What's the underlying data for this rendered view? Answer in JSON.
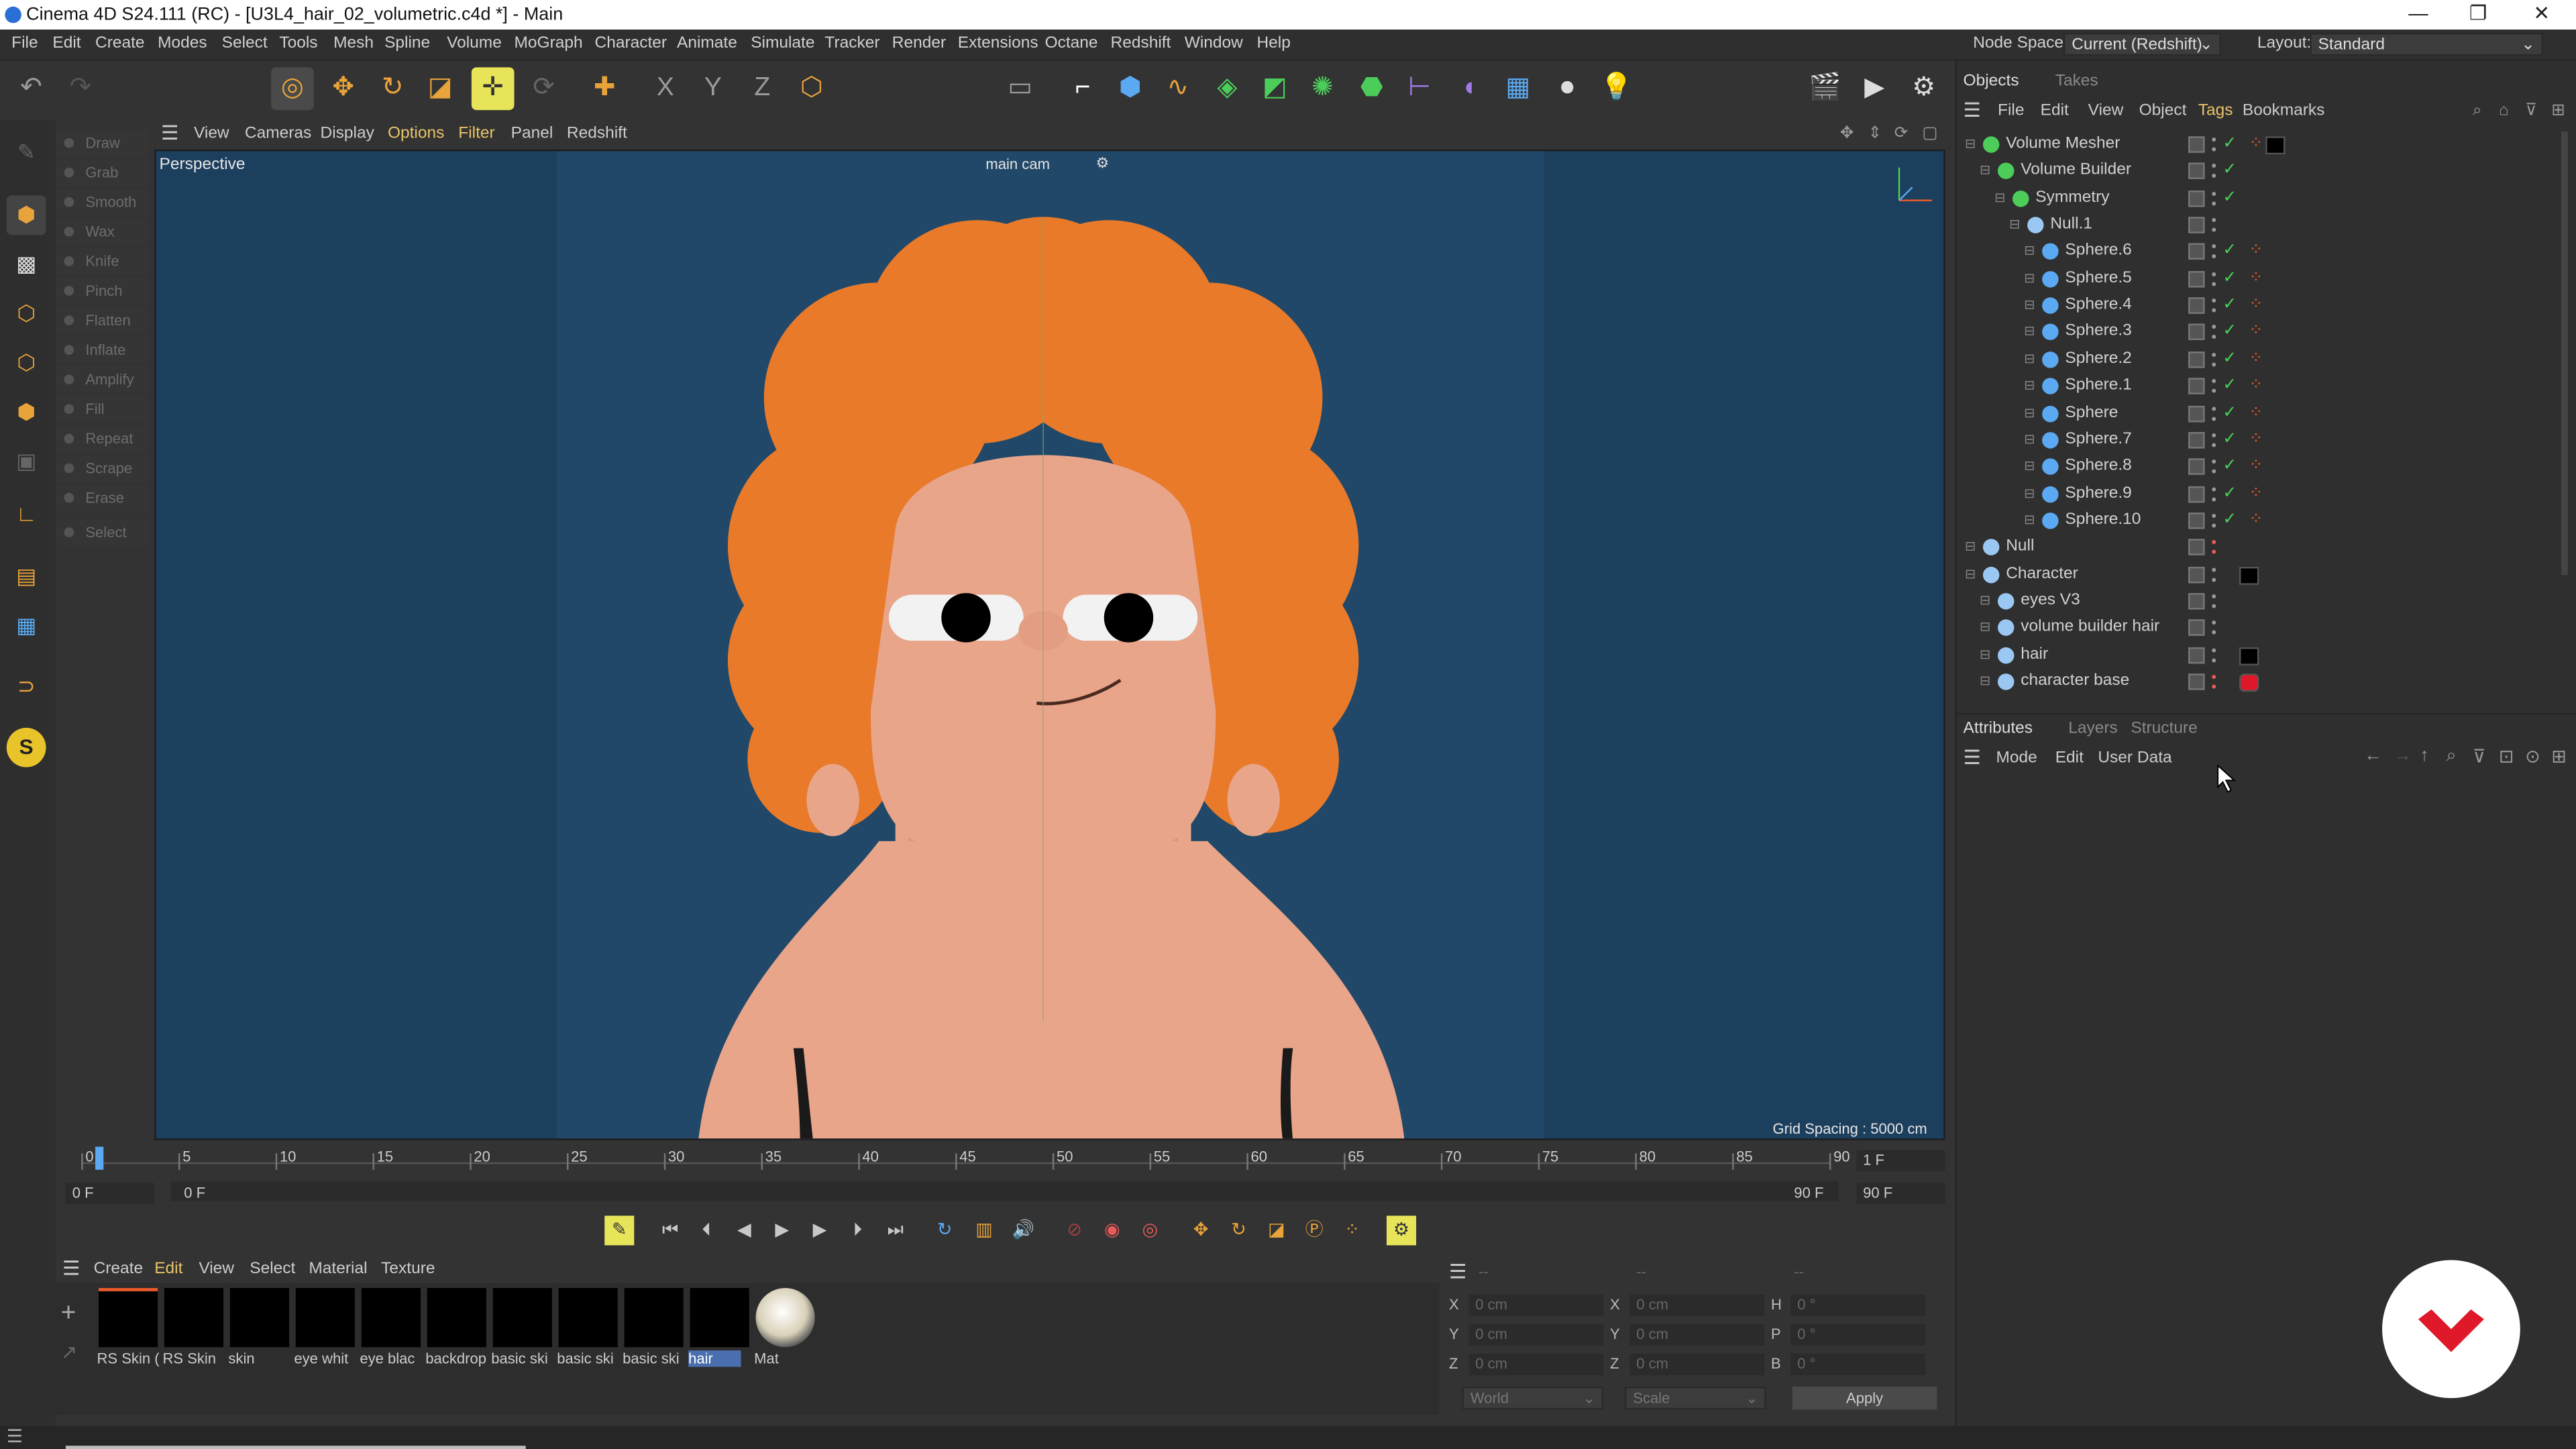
{
  "window": {
    "title": "Cinema 4D S24.111 (RC) - [U3L4_hair_02_volumetric.c4d *] - Main",
    "min": "—",
    "max": "❐",
    "close": "✕"
  },
  "menu": [
    "File",
    "Edit",
    "Create",
    "Modes",
    "Select",
    "Tools",
    "Mesh",
    "Spline",
    "Volume",
    "MoGraph",
    "Character",
    "Animate",
    "Simulate",
    "Tracker",
    "Render",
    "Extensions",
    "Octane",
    "Redshift",
    "Window",
    "Help"
  ],
  "nodespace": {
    "label": "Node Space:",
    "value": "Current (Redshift)"
  },
  "layout": {
    "label": "Layout:",
    "value": "Standard"
  },
  "sculpt_tools": [
    "Draw",
    "Grab",
    "Smooth",
    "Wax",
    "Knife",
    "Pinch",
    "Flatten",
    "Inflate",
    "Amplify",
    "Fill",
    "Repeat",
    "Scrape",
    "Erase",
    "Select"
  ],
  "viewport_menu": [
    "View",
    "Cameras",
    "Display",
    "Options",
    "Filter",
    "Panel",
    "Redshift"
  ],
  "viewport": {
    "name": "Perspective",
    "camera": "main cam",
    "grid": "Grid Spacing : 5000 cm"
  },
  "timeline": {
    "ticks": [
      "0",
      "5",
      "10",
      "15",
      "20",
      "25",
      "30",
      "35",
      "40",
      "45",
      "50",
      "55",
      "60",
      "65",
      "70",
      "75",
      "80",
      "85",
      "90"
    ],
    "current_frame": "1 F",
    "start": "0 F",
    "range_start": "0 F",
    "range_end": "90 F",
    "end": "90 F"
  },
  "material_menu": [
    "Create",
    "Edit",
    "View",
    "Select",
    "Material",
    "Texture"
  ],
  "materials": [
    "RS Skin (",
    "RS Skin",
    "skin",
    "eye whit",
    "eye blac",
    "backdrop",
    "basic ski",
    "basic ski",
    "basic ski",
    "hair",
    "Mat"
  ],
  "coords": {
    "header": [
      "--",
      "--",
      "--"
    ],
    "rows": [
      {
        "a": "X",
        "va": "0 cm",
        "b": "X",
        "vb": "0 cm",
        "c": "H",
        "vc": "0 °"
      },
      {
        "a": "Y",
        "va": "0 cm",
        "b": "Y",
        "vb": "0 cm",
        "c": "P",
        "vc": "0 °"
      },
      {
        "a": "Z",
        "va": "0 cm",
        "b": "Z",
        "vb": "0 cm",
        "c": "B",
        "vc": "0 °"
      }
    ],
    "world": "World",
    "scale": "Scale",
    "apply": "Apply"
  },
  "objects_tabs": [
    "Objects",
    "Takes"
  ],
  "objects_menu": [
    "File",
    "Edit",
    "View",
    "Object",
    "Tags",
    "Bookmarks"
  ],
  "objects": [
    {
      "name": "Volume Mesher",
      "indent": 0,
      "color": "#4ccd5a",
      "tag": "swatch"
    },
    {
      "name": "Volume Builder",
      "indent": 1,
      "color": "#4ccd5a",
      "tag": "none"
    },
    {
      "name": "Symmetry",
      "indent": 2,
      "color": "#4ccd5a",
      "tag": "none"
    },
    {
      "name": "Null.1",
      "indent": 3,
      "color": "#9bc8f2",
      "tag": "none"
    },
    {
      "name": "Sphere.6",
      "indent": 4,
      "color": "#5aa9f2",
      "tag": "phong"
    },
    {
      "name": "Sphere.5",
      "indent": 4,
      "color": "#5aa9f2",
      "tag": "phong"
    },
    {
      "name": "Sphere.4",
      "indent": 4,
      "color": "#5aa9f2",
      "tag": "phong"
    },
    {
      "name": "Sphere.3",
      "indent": 4,
      "color": "#5aa9f2",
      "tag": "phong"
    },
    {
      "name": "Sphere.2",
      "indent": 4,
      "color": "#5aa9f2",
      "tag": "phong"
    },
    {
      "name": "Sphere.1",
      "indent": 4,
      "color": "#5aa9f2",
      "tag": "phong"
    },
    {
      "name": "Sphere",
      "indent": 4,
      "color": "#5aa9f2",
      "tag": "phong"
    },
    {
      "name": "Sphere.7",
      "indent": 4,
      "color": "#5aa9f2",
      "tag": "phong"
    },
    {
      "name": "Sphere.8",
      "indent": 4,
      "color": "#5aa9f2",
      "tag": "phong"
    },
    {
      "name": "Sphere.9",
      "indent": 4,
      "color": "#5aa9f2",
      "tag": "phong"
    },
    {
      "name": "Sphere.10",
      "indent": 4,
      "color": "#5aa9f2",
      "tag": "phong"
    },
    {
      "name": "Null",
      "indent": 0,
      "color": "#9bc8f2",
      "tag": "none"
    },
    {
      "name": "Character",
      "indent": 0,
      "color": "#9bc8f2",
      "tag": "swatch"
    },
    {
      "name": "eyes V3",
      "indent": 1,
      "color": "#9bc8f2",
      "tag": "none"
    },
    {
      "name": "volume builder hair",
      "indent": 1,
      "color": "#9bc8f2",
      "tag": "none"
    },
    {
      "name": "hair",
      "indent": 1,
      "color": "#9bc8f2",
      "tag": "swatch"
    },
    {
      "name": "character base",
      "indent": 1,
      "color": "#9bc8f2",
      "tag": "red"
    }
  ],
  "attr_tabs": [
    "Attributes",
    "Layers",
    "Structure"
  ],
  "attr_menu": [
    "Mode",
    "Edit",
    "User Data"
  ]
}
